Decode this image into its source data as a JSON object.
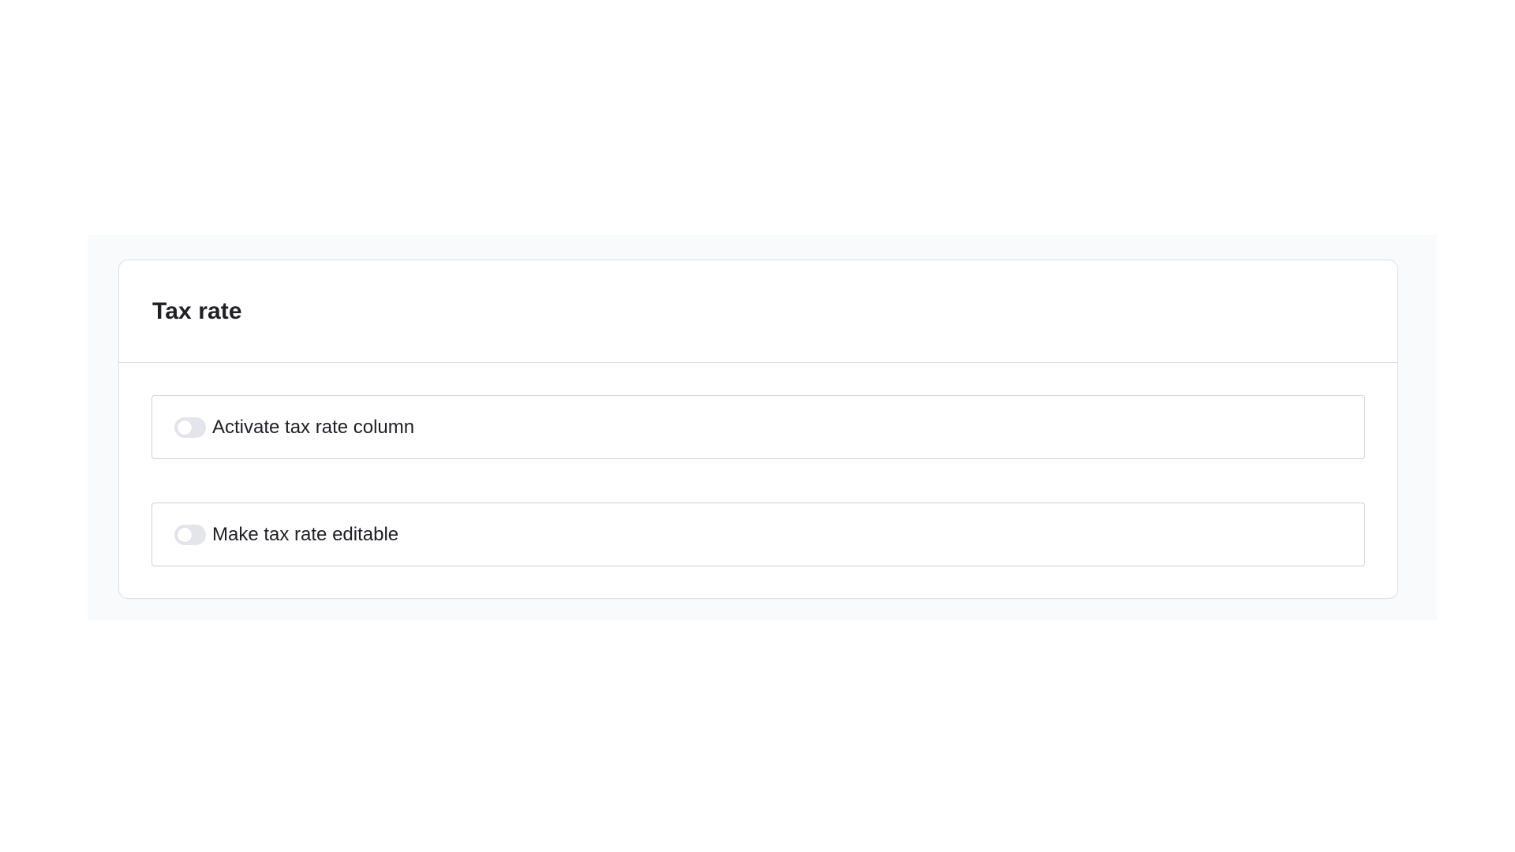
{
  "section": {
    "title": "Tax rate"
  },
  "toggles": [
    {
      "label": "Activate tax rate column",
      "enabled": false
    },
    {
      "label": "Make tax rate editable",
      "enabled": false
    }
  ],
  "colors": {
    "backdrop": "#f9fafc",
    "card_border": "#dedfe3",
    "row_border": "#cfd0d4",
    "switch_off": "#e4e5ea",
    "text": "#1f1f24"
  }
}
